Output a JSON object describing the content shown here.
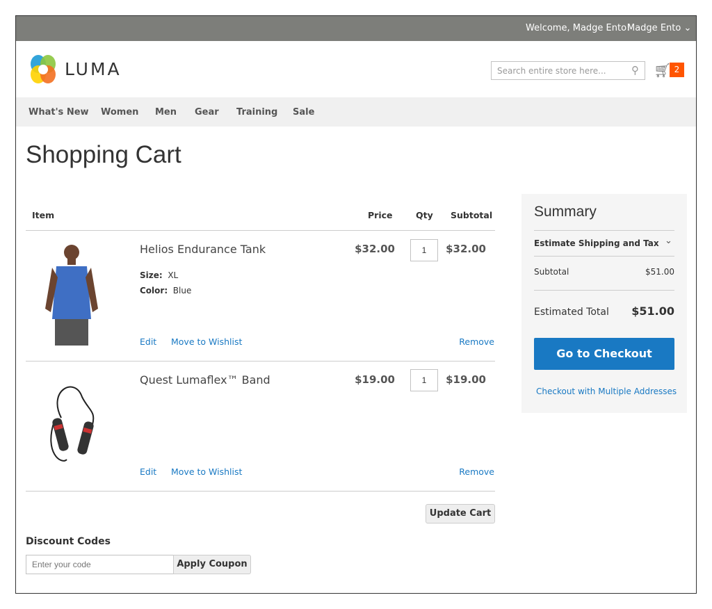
{
  "topbar": {
    "welcome": "Welcome, Madge Ento!",
    "account": "Madge Ento ⌄"
  },
  "header": {
    "logo_text": "LUMA",
    "search_placeholder": "Search entire store here...",
    "cart_count": "2"
  },
  "nav": [
    "What's New",
    "Women",
    "Men",
    "Gear",
    "Training",
    "Sale"
  ],
  "page_title": "Shopping Cart",
  "table": {
    "headers": {
      "item": "Item",
      "price": "Price",
      "qty": "Qty",
      "subtotal": "Subtotal"
    },
    "rows": [
      {
        "name": "Helios Endurance Tank",
        "price": "$32.00",
        "qty": "1",
        "subtotal": "$32.00",
        "options": [
          {
            "label": "Size:",
            "value": "XL"
          },
          {
            "label": "Color:",
            "value": "Blue"
          }
        ],
        "edit": "Edit",
        "wishlist": "Move to Wishlist",
        "remove": "Remove"
      },
      {
        "name": "Quest Lumaflex™ Band",
        "price": "$19.00",
        "qty": "1",
        "subtotal": "$19.00",
        "edit": "Edit",
        "wishlist": "Move to Wishlist",
        "remove": "Remove"
      }
    ]
  },
  "update_cart": "Update Cart",
  "discount": {
    "title": "Discount Codes",
    "placeholder": "Enter your code",
    "apply": "Apply Coupon"
  },
  "summary": {
    "title": "Summary",
    "shipping": "Estimate Shipping and Tax",
    "subtotal_label": "Subtotal",
    "subtotal": "$51.00",
    "total_label": "Estimated Total",
    "total": "$51.00",
    "checkout": "Go to Checkout",
    "multi": "Checkout with Multiple Addresses"
  },
  "colors": {
    "accent": "#1979c3",
    "cart_badge": "#ff5501",
    "topbar": "#7d7e7a"
  }
}
